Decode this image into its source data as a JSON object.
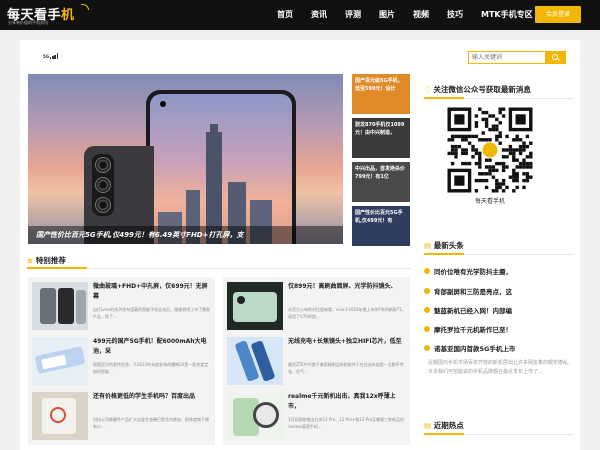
{
  "header": {
    "logo_text_a": "每天看手",
    "logo_text_b": "机",
    "logo_tagline": "分享有价值的手机资讯",
    "nav": [
      {
        "label": "首页"
      },
      {
        "label": "资讯"
      },
      {
        "label": "评测"
      },
      {
        "label": "图片"
      },
      {
        "label": "视频"
      },
      {
        "label": "技巧"
      },
      {
        "label": "MTK手机专区"
      }
    ],
    "login_label": "会员登录"
  },
  "signal_label": "5G",
  "search": {
    "placeholder": "输入关键词",
    "icon": "search-icon"
  },
  "hero": {
    "caption": "国产性价比百元5G手机,仅499元！有6.49英寸FHD+打孔屏，支",
    "side_items": [
      {
        "title": "国产百元级5G手机，低至599元！设计"
      },
      {
        "title": "骁龙870手机仅1099元！由中兴制造，"
      },
      {
        "title": "中兴出品，首发绝杀价799元！有1亿"
      },
      {
        "title": "国产性价比百元5G手机,仅499元！有"
      }
    ]
  },
  "recommend": {
    "title": "特别推荐",
    "icon": "wifi-icon",
    "cards": [
      {
        "title": "微曲玻璃+FHD+中孔屏，仅699元！无屏幕",
        "desc": "自打Lens的系列发布搭载的智能手机业务后，随便就续上市了数款产品，除了..."
      },
      {
        "title": "仅899元！高刷曲面屏、光学防抖镜头、",
        "desc": "从官方公布的对比图来看，vivo于2023年推上市的Y系列新款T1，采用了V70的造..."
      },
      {
        "title": "499元的国产5G手机！配6000mAh大电池，采",
        "desc": "搜狐官方的宣传信息，于2023年年底发布的播映20是一款夹爱定取的智能..."
      },
      {
        "title": "无线充电+长焦镜头+独立HIFI芯片，低至",
        "desc": "最优ZTE中兴旗下拿家精制品所相给件于在过去年前是一点都不夸张，在气..."
      },
      {
        "title": "还有价格更低的学生手机吗？百度出品",
        "desc": "科技公司做硬件产品扩大自身生态圈已是业内常态，前阵度旗下便有小..."
      },
      {
        "title": "realme千元新机出击，真我12x呼薄上市，",
        "desc": "1月初刚刚推出红米12 Pro、12 Pro+和12 Pro至尊版三款新品的realme真我手机..."
      }
    ]
  },
  "sidebar": {
    "wechat_title": "关注微信公众号获取最新消息",
    "wechat_icon": "heart-icon",
    "qr_label": "每天看手机",
    "headlines_title": "最新头条",
    "headlines_icon": "doc-icon",
    "headlines": [
      {
        "n": "1",
        "text": "同价位唯有光学防抖主摄，"
      },
      {
        "n": "2",
        "text": "背部副屏和三防是亮点，这"
      },
      {
        "n": "3",
        "text": "魅蓝新机已经入网！内部编"
      },
      {
        "n": "4",
        "text": "摩托罗拉千元机新作已至！"
      },
      {
        "n": "5",
        "text": "诺基亚国内首款5G手机上市"
      }
    ],
    "headlines_desc": "近期国内手机市场百花齐放的新机层出让许多网友着的眼花缭乱，许多我们可拍能说的手机品牌都在最近发布上市了...",
    "hot_title": "近期热点",
    "hot_icon": "doc-icon",
    "accent": "#f2b705"
  }
}
